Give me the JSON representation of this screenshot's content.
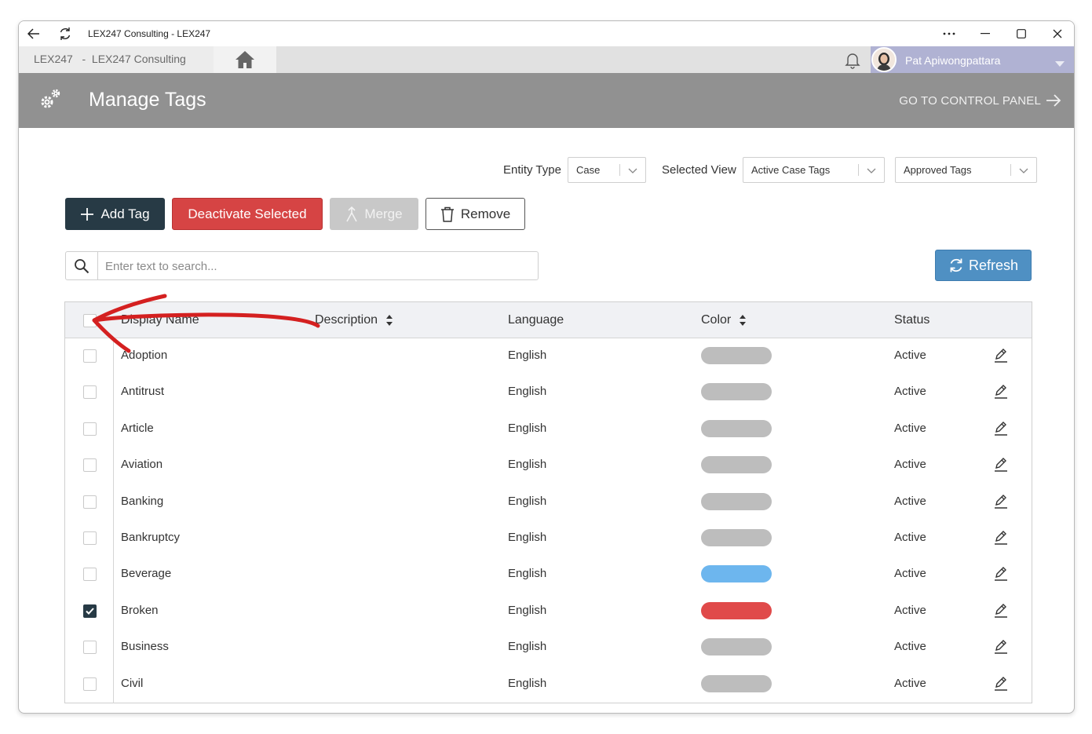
{
  "window": {
    "title": "LEX247 Consulting - LEX247",
    "controls": [
      "more-icon",
      "minimize-icon",
      "maximize-icon",
      "close-icon"
    ]
  },
  "tabbar": {
    "app_label": "LEX247   -  LEX247 Consulting",
    "user_name": "Pat Apiwongpattara"
  },
  "header": {
    "title": "Manage Tags",
    "control_panel_link": "GO TO CONTROL PANEL"
  },
  "filters": {
    "entity_type_label": "Entity Type",
    "entity_type_value": "Case",
    "selected_view_label": "Selected View",
    "selected_view_value": "Active Case Tags",
    "approval_value": "Approved Tags"
  },
  "toolbar": {
    "add_label": "Add Tag",
    "deactivate_label": "Deactivate Selected",
    "merge_label": "Merge",
    "remove_label": "Remove",
    "refresh_label": "Refresh"
  },
  "search": {
    "placeholder": "Enter text to search..."
  },
  "table": {
    "columns": [
      "Display Name",
      "Description",
      "Language",
      "Color",
      "Status"
    ],
    "rows": [
      {
        "name": "Adoption",
        "language": "English",
        "color": "#bdbdbd",
        "status": "Active",
        "checked": false
      },
      {
        "name": "Antitrust",
        "language": "English",
        "color": "#bdbdbd",
        "status": "Active",
        "checked": false
      },
      {
        "name": "Article",
        "language": "English",
        "color": "#bdbdbd",
        "status": "Active",
        "checked": false
      },
      {
        "name": "Aviation",
        "language": "English",
        "color": "#bdbdbd",
        "status": "Active",
        "checked": false
      },
      {
        "name": "Banking",
        "language": "English",
        "color": "#bdbdbd",
        "status": "Active",
        "checked": false
      },
      {
        "name": "Bankruptcy",
        "language": "English",
        "color": "#bdbdbd",
        "status": "Active",
        "checked": false
      },
      {
        "name": "Beverage",
        "language": "English",
        "color": "#6db6ee",
        "status": "Active",
        "checked": false
      },
      {
        "name": "Broken",
        "language": "English",
        "color": "#e04a4a",
        "status": "Active",
        "checked": true
      },
      {
        "name": "Business",
        "language": "English",
        "color": "#bdbdbd",
        "status": "Active",
        "checked": false
      },
      {
        "name": "Civil",
        "language": "English",
        "color": "#bdbdbd",
        "status": "Active",
        "checked": false
      }
    ]
  },
  "colors": {
    "header_bg": "#919191",
    "primary_dark": "#273a45",
    "danger": "#d64444",
    "refresh": "#4f90c3",
    "annotation_red": "#d42020"
  }
}
